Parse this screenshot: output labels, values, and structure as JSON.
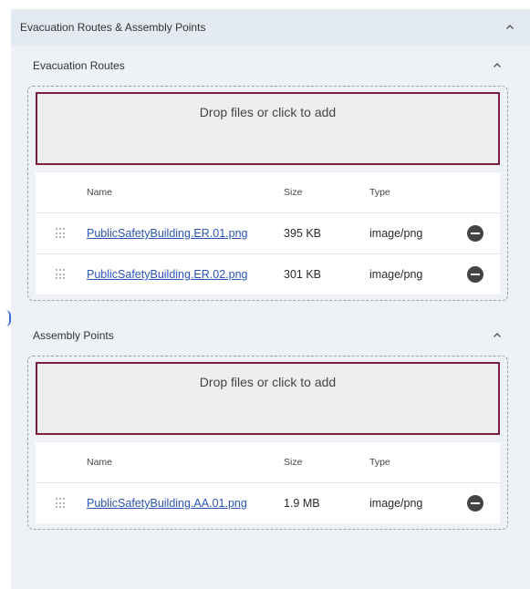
{
  "panel": {
    "title": "Evacuation Routes & Assembly Points",
    "collapse_icon": "chevron-up-icon"
  },
  "sections": [
    {
      "title": "Evacuation Routes",
      "drop_text": "Drop files or click to add",
      "columns": {
        "name": "Name",
        "size": "Size",
        "type": "Type"
      },
      "files": [
        {
          "name": "PublicSafetyBuilding.ER.01.png",
          "size": "395 KB",
          "type": "image/png"
        },
        {
          "name": "PublicSafetyBuilding.ER.02.png",
          "size": "301 KB",
          "type": "image/png"
        }
      ]
    },
    {
      "title": "Assembly Points",
      "drop_text": "Drop files or click to add",
      "columns": {
        "name": "Name",
        "size": "Size",
        "type": "Type"
      },
      "files": [
        {
          "name": "PublicSafetyBuilding.AA.01.png",
          "size": "1.9 MB",
          "type": "image/png"
        }
      ]
    }
  ],
  "colors": {
    "accent_border": "#7a1f3d",
    "link": "#2b55b5",
    "panel_bg": "#eef2f7"
  }
}
